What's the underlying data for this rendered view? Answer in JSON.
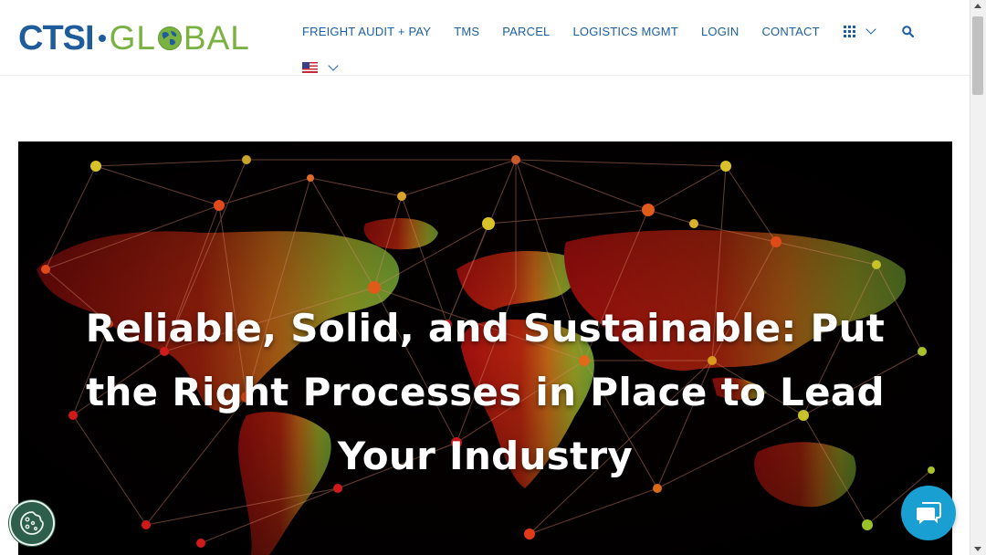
{
  "brand": {
    "logo_part1": "CTSI",
    "logo_part2a": "GL",
    "logo_part2b": "BAL",
    "primary_color": "#1f5c9c",
    "secondary_color": "#7ab241"
  },
  "nav": {
    "items": [
      {
        "label": "FREIGHT AUDIT + PAY"
      },
      {
        "label": "TMS"
      },
      {
        "label": "PARCEL"
      },
      {
        "label": "LOGISTICS MGMT"
      },
      {
        "label": "LOGIN"
      },
      {
        "label": "CONTACT"
      }
    ],
    "apps_icon": "grid-icon",
    "search_icon": "search-icon",
    "language_icon": "us-flag-icon"
  },
  "hero": {
    "title": "Reliable, Solid, and Sustainable: Put the Right Processes in Place to Lead Your Industry",
    "background": "world-network-map"
  },
  "widgets": {
    "cookie_icon": "cookie-icon",
    "chat_icon": "chat-bubbles-icon",
    "chat_color": "#1a9fd3",
    "cookie_color": "#2d5f4c"
  }
}
